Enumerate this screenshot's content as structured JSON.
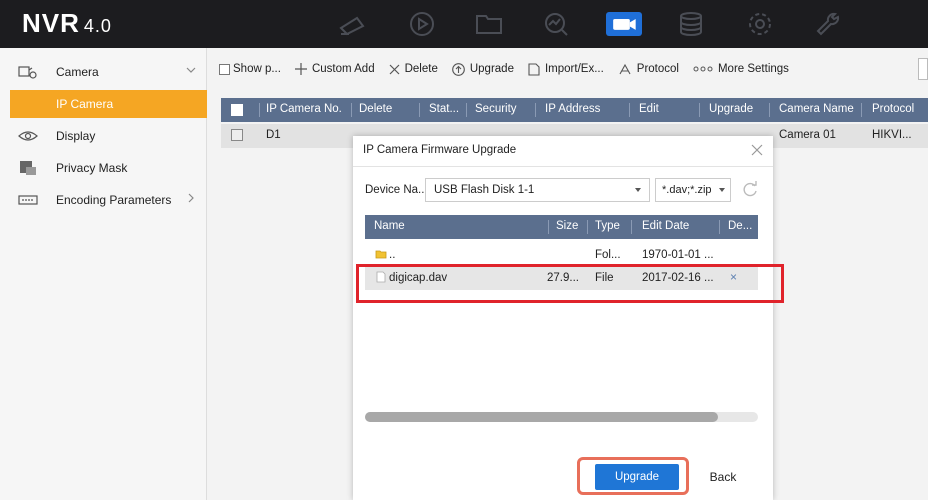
{
  "app": {
    "logo": "NVR",
    "version": "4.0"
  },
  "topnav": [
    {
      "icon": "camera-playback-icon"
    },
    {
      "icon": "playback-icon"
    },
    {
      "icon": "folder-icon"
    },
    {
      "icon": "search-icon"
    },
    {
      "icon": "camera-icon",
      "active": true
    },
    {
      "icon": "storage-icon"
    },
    {
      "icon": "gear-icon"
    },
    {
      "icon": "wrench-icon"
    }
  ],
  "sidebar": {
    "items": [
      {
        "label": "Camera",
        "icon": "camera-settings-icon",
        "expanded": true
      },
      {
        "label": "IP Camera",
        "selected": true
      },
      {
        "label": "Display",
        "icon": "eye-icon"
      },
      {
        "label": "Privacy Mask",
        "icon": "mask-icon"
      },
      {
        "label": "Encoding Parameters",
        "icon": "encoding-icon"
      }
    ]
  },
  "toolbar": {
    "show_password": "Show p...",
    "custom_add": "Custom Add",
    "delete": "Delete",
    "upgrade": "Upgrade",
    "import_export": "Import/Ex...",
    "protocol": "Protocol",
    "more_settings": "More Settings"
  },
  "camera_table": {
    "headers": [
      "IP Camera No.",
      "Delete",
      "Stat...",
      "Security",
      "IP Address",
      "Edit",
      "Upgrade",
      "Camera Name",
      "Protocol"
    ],
    "rows": [
      {
        "no": "D1",
        "camera_name": "Camera 01",
        "protocol": "HIKVI..."
      }
    ]
  },
  "dialog": {
    "title": "IP Camera Firmware Upgrade",
    "device_label": "Device Na...",
    "device_value": "USB Flash Disk 1-1",
    "ext_value": "*.dav;*.zip",
    "file_table": {
      "headers": [
        "Name",
        "Size",
        "Type",
        "Edit Date",
        "De..."
      ],
      "rows": [
        {
          "name": "..",
          "size": "",
          "type": "Fol...",
          "date": "1970-01-01 ...",
          "delete": ""
        },
        {
          "name": "digicap.dav",
          "size": "27.9...",
          "type": "File",
          "date": "2017-02-16 ...",
          "delete": "×"
        }
      ]
    },
    "upgrade_button": "Upgrade",
    "back_button": "Back"
  }
}
